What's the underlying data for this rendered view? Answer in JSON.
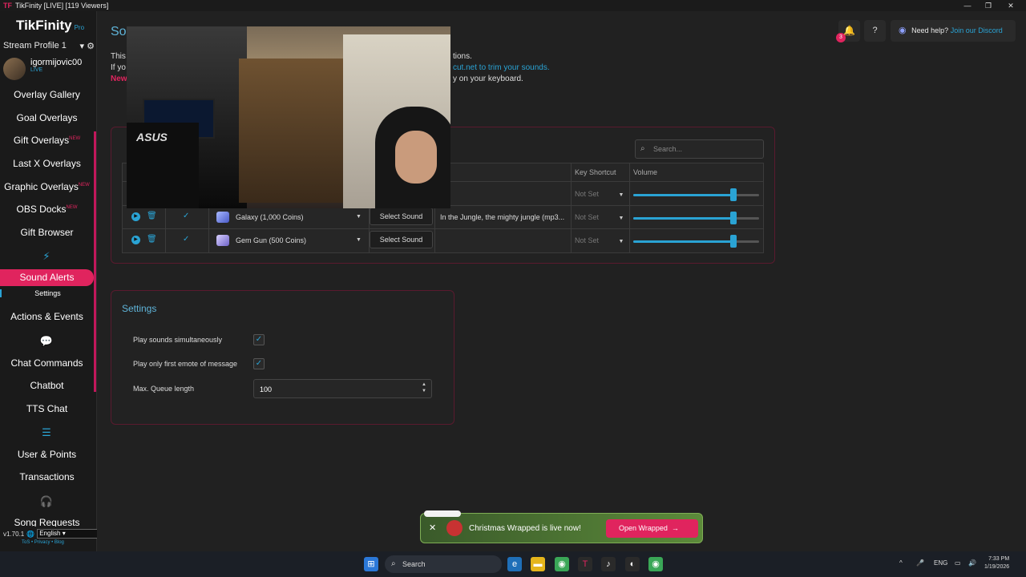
{
  "window": {
    "title": "TikFinity [LIVE] [119 Viewers]",
    "logo": "TF",
    "controls": [
      "—",
      "❐",
      "✕"
    ]
  },
  "sidebar": {
    "brand": "TikFinity",
    "brand_suffix": "Pro",
    "profile": "Stream Profile 1",
    "username": "igormijovic00",
    "status": "LIVE",
    "items": [
      {
        "label": "Overlay Gallery"
      },
      {
        "label": "Goal Overlays"
      },
      {
        "label": "Gift Overlays",
        "badge": "NEW"
      },
      {
        "label": "Last X Overlays"
      },
      {
        "label": "Graphic Overlays",
        "badge": "NEW"
      },
      {
        "label": "OBS Docks",
        "badge": "NEW"
      },
      {
        "label": "Gift Browser"
      },
      {
        "label": "Sound Alerts",
        "active": true
      },
      {
        "label": "Settings"
      },
      {
        "label": "Actions & Events"
      },
      {
        "label": "Chat Commands"
      },
      {
        "label": "Chatbot"
      },
      {
        "label": "TTS Chat"
      },
      {
        "label": "User & Points"
      },
      {
        "label": "Transactions"
      },
      {
        "label": "Song Requests"
      }
    ],
    "version": "v1.70.1",
    "language": "English",
    "footer_links": "ToS • Privacy • Blog"
  },
  "header": {
    "notification_count": "3",
    "help_text": "Need help?",
    "discord_link": "Join our Discord"
  },
  "page": {
    "title": "So",
    "intro_lines": [
      "This",
      "If yo",
      "New"
    ],
    "intro_right": [
      "tions.",
      "cut.net to trim your sounds.",
      "y on your keyboard."
    ]
  },
  "sounds": {
    "search_placeholder": "Search...",
    "columns": {
      "key_shortcut": "Key Shortcut",
      "volume": "Volume"
    },
    "rows": [
      {
        "gift": "",
        "button": "",
        "file": "",
        "shortcut": "Not Set",
        "volume": 0.82
      },
      {
        "gift": "Galaxy (1,000 Coins)",
        "button": "Select Sound",
        "file": "In the Jungle, the mighty jungle (mp3...",
        "shortcut": "Not Set",
        "volume": 0.82
      },
      {
        "gift": "Gem Gun (500 Coins)",
        "button": "Select Sound",
        "file": "",
        "shortcut": "Not Set",
        "volume": 0.82
      }
    ]
  },
  "settings": {
    "title": "Settings",
    "play_simultaneously": "Play sounds simultaneously",
    "first_emote": "Play only first emote of message",
    "max_queue_label": "Max. Queue length",
    "max_queue_value": "100"
  },
  "toast": {
    "message": "Christmas Wrapped is live now!",
    "button": "Open Wrapped"
  },
  "taskbar": {
    "search": "Search",
    "lang": "ENG",
    "time": "7:33 PM",
    "date": "1/19/2026"
  }
}
